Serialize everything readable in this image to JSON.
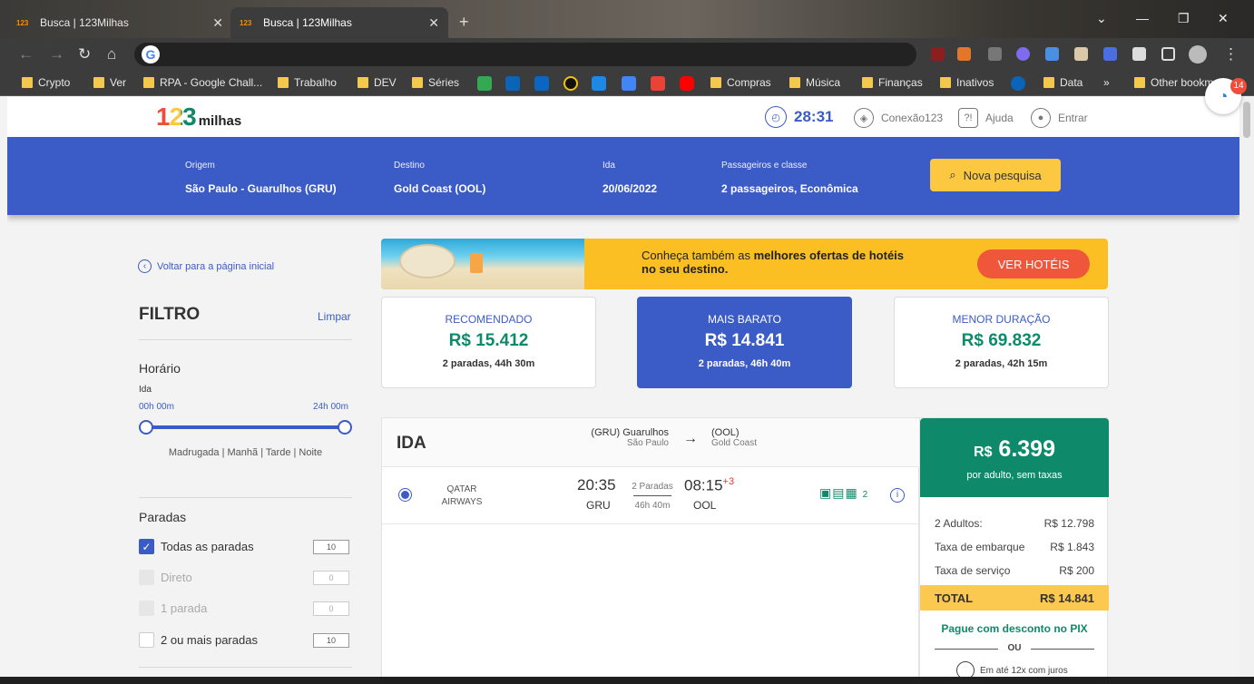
{
  "browser": {
    "tabs": [
      {
        "favicon": "123",
        "title": "Busca | 123Milhas",
        "close": "✕"
      },
      {
        "favicon": "123",
        "title": "Busca | 123Milhas",
        "close": "✕"
      }
    ],
    "new_tab": "+",
    "bookmarks": [
      "Crypto",
      "Ver",
      "RPA - Google Chall...",
      "Trabalho",
      "DEV",
      "Séries",
      "Compras",
      "Música",
      "Finanças",
      "Inativos",
      "Data",
      "»",
      "Other bookmarks"
    ]
  },
  "header": {
    "logo_number": "123",
    "logo_word": "milhas",
    "timer": "28:31",
    "conexao": "Conexão123",
    "ajuda": "Ajuda",
    "entrar": "Entrar"
  },
  "search": {
    "origem_label": "Origem",
    "origem_value": "São Paulo - Guarulhos (GRU)",
    "destino_label": "Destino",
    "destino_value": "Gold Coast (OOL)",
    "ida_label": "Ida",
    "ida_value": "20/06/2022",
    "pax_label": "Passageiros e classe",
    "pax_value": "2 passageiros, Econômica",
    "nova_pesquisa": "Nova pesquisa"
  },
  "sidebar": {
    "back_link": "Voltar para a página inicial",
    "filtro_title": "FILTRO",
    "limpar": "Limpar",
    "horario_title": "Horário",
    "ida_label": "Ida",
    "range_start": "00h 00m",
    "range_end": "24h 00m",
    "periods": "Madrugada | Manhã | Tarde | Noite",
    "paradas_title": "Paradas",
    "stops": [
      {
        "label": "Todas as paradas",
        "count": "10"
      },
      {
        "label": "Direto",
        "count": "0"
      },
      {
        "label": "1 parada",
        "count": "0"
      },
      {
        "label": "2 ou mais paradas",
        "count": "10"
      }
    ]
  },
  "banner": {
    "text_prefix": "Conheça também as ",
    "text_bold": "melhores ofertas de hotéis",
    "text_line2": "no seu destino.",
    "button": "VER HOTÉIS"
  },
  "sort": [
    {
      "label": "RECOMENDADO",
      "price": "R$ 15.412",
      "sub": "2 paradas, 44h 30m"
    },
    {
      "label": "MAIS BARATO",
      "price": "R$ 14.841",
      "sub": "2 paradas, 46h 40m"
    },
    {
      "label": "MENOR DURAÇÃO",
      "price": "R$ 69.832",
      "sub": "2 paradas, 42h 15m"
    }
  ],
  "flight": {
    "direction": "IDA",
    "origin_code": "(GRU) Guarulhos",
    "origin_city": "São Paulo",
    "dest_code": "(OOL)",
    "dest_city": "Gold Coast",
    "airline_line1": "QATAR",
    "airline_line2": "AIRWAYS",
    "depart_time": "20:35",
    "depart_airport": "GRU",
    "stops": "2 Paradas",
    "duration": "46h 40m",
    "arrive_time": "08:15",
    "arrive_plus": "+3",
    "arrive_airport": "OOL",
    "bag_count": "2"
  },
  "price": {
    "currency": "R$",
    "amount": "6.399",
    "per_adult": "por adulto, sem taxas",
    "adults_label": "2 Adultos:",
    "adults_value": "R$ 12.798",
    "taxa_embarque_label": "Taxa de embarque",
    "taxa_embarque_value": "R$ 1.843",
    "taxa_servico_label": "Taxa de serviço",
    "taxa_servico_value": "R$ 200",
    "total_label": "TOTAL",
    "total_value": "R$ 14.841",
    "pix": "Pague com desconto no PIX",
    "ou": "OU",
    "juros": "Em até 12x com juros"
  },
  "chat_badge": "14",
  "colors": {
    "brand_blue": "#3b5bc7",
    "green": "#0e8a6a",
    "yellow": "#fcc842",
    "red": "#f0563a"
  }
}
